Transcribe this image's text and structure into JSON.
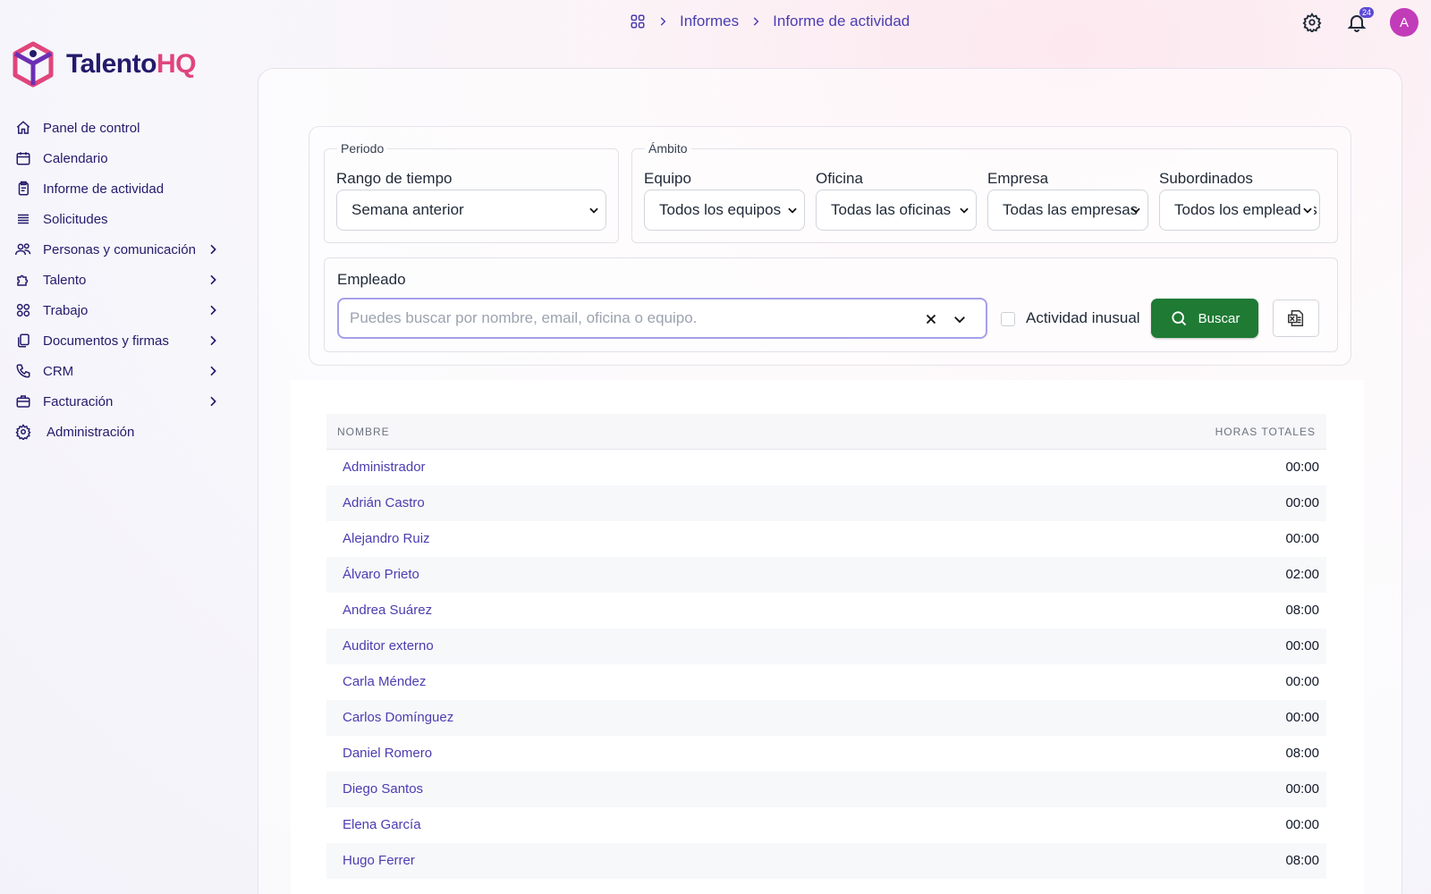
{
  "brand": {
    "name_part1": "Talento",
    "name_part2": "HQ"
  },
  "sidebar": {
    "items": [
      {
        "label": "Panel de control",
        "icon": "home-icon"
      },
      {
        "label": "Calendario",
        "icon": "calendar-icon"
      },
      {
        "label": "Informe de actividad",
        "icon": "report-icon"
      },
      {
        "label": "Solicitudes",
        "icon": "list-icon"
      },
      {
        "label": "Personas y comunicación",
        "icon": "people-icon"
      },
      {
        "label": "Talento",
        "icon": "puzzle-icon"
      },
      {
        "label": "Trabajo",
        "icon": "grid-icon"
      },
      {
        "label": "Documentos y firmas",
        "icon": "documents-icon"
      },
      {
        "label": "CRM",
        "icon": "phone-icon"
      },
      {
        "label": "Facturación",
        "icon": "briefcase-icon"
      },
      {
        "label": "Administración",
        "icon": "gear-icon"
      }
    ]
  },
  "breadcrumb": {
    "level1": "Informes",
    "level2": "Informe de actividad"
  },
  "topbar": {
    "notifications_count": "24",
    "avatar_initial": "A"
  },
  "filters": {
    "periodo_legend": "Periodo",
    "ambito_legend": "Ámbito",
    "rango_label": "Rango de tiempo",
    "rango_value": "Semana anterior",
    "equipo_label": "Equipo",
    "equipo_value": "Todos los equipos",
    "oficina_label": "Oficina",
    "oficina_value": "Todas las oficinas",
    "empresa_label": "Empresa",
    "empresa_value": "Todas las empresas",
    "subordinados_label": "Subordinados",
    "subordinados_value": "Todos los empleados",
    "empleado_label": "Empleado",
    "empleado_placeholder": "Puedes buscar por nombre, email, oficina o equipo.",
    "actividad_label": "Actividad inusual",
    "actividad_checked": false,
    "buscar_label": "Buscar"
  },
  "table": {
    "col_name": "NOMBRE",
    "col_hours": "HORAS TOTALES",
    "rows": [
      {
        "name": "Administrador",
        "hours": "00:00"
      },
      {
        "name": "Adrián Castro",
        "hours": "00:00"
      },
      {
        "name": "Alejandro Ruiz",
        "hours": "00:00"
      },
      {
        "name": "Álvaro Prieto",
        "hours": "02:00"
      },
      {
        "name": "Andrea Suárez",
        "hours": "08:00"
      },
      {
        "name": "Auditor externo",
        "hours": "00:00"
      },
      {
        "name": "Carla Méndez",
        "hours": "00:00"
      },
      {
        "name": "Carlos Domínguez",
        "hours": "00:00"
      },
      {
        "name": "Daniel Romero",
        "hours": "08:00"
      },
      {
        "name": "Diego Santos",
        "hours": "00:00"
      },
      {
        "name": "Elena García",
        "hours": "00:00"
      },
      {
        "name": "Hugo Ferrer",
        "hours": "08:00"
      }
    ]
  },
  "colors": {
    "brand_dark": "#241a6b",
    "brand_pink": "#e0457b",
    "link": "#4b3db0",
    "search_button": "#1f7a34",
    "avatar": "#c23cb9"
  }
}
